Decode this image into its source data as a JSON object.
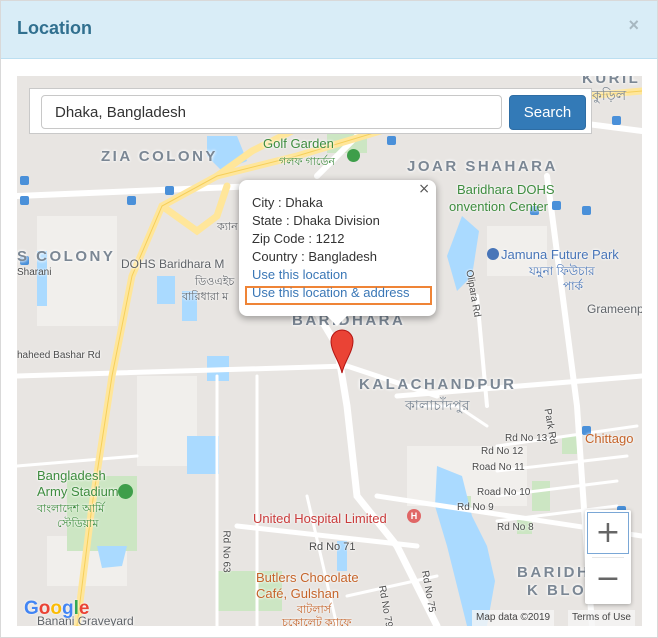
{
  "modal": {
    "title": "Location",
    "close_icon": "×"
  },
  "search": {
    "value": "Dhaka, Bangladesh",
    "button_label": "Search"
  },
  "info_window": {
    "close_icon": "×",
    "city": "City : Dhaka",
    "state": "State : Dhaka Division",
    "zip": "Zip Code : 1212",
    "country": "Country : Bangladesh",
    "link_location": "Use this location",
    "link_location_address": "Use this location & address"
  },
  "map_labels": {
    "zia_colony": "ZIA COLONY",
    "colony": "S COLONY",
    "joar_shahara": "JOAR SHAHARA",
    "baridhara": "BARIDHARA",
    "kalachandpur": "KALACHANDPUR",
    "kalachandpur_bn": "কালাচাঁদপুর",
    "baridhara_block": "BARIDHA",
    "baridhara_block2": "K BLOC",
    "golf_garden": "Golf Garden",
    "golf_garden_bn": "গলফ গার্ডেন",
    "baridhara_dohs": "Baridhara DOHS",
    "convention_center": "onvention Center",
    "jamuna": "Jamuna Future Park",
    "jamuna_bn": "যমুনা ফিউচার",
    "jamuna_bn2": "পার্ক",
    "grameenphone": "Grameenpł",
    "dohs_baridhara": "DOHS Baridhara M",
    "dohs_bn": "ডিওএইচ",
    "dohs_bn2": "বারিধারা ম",
    "bd_army_stadium": "Bangladesh",
    "bd_army_stadium2": "Army Stadium",
    "bd_army_bn": "বাংলাদেশ আর্মি",
    "bd_army_bn2": "স্টেডিয়াম",
    "united_hospital": "United Hospital Limited",
    "butlers": "Butlers Chocolate",
    "butlers2": "Café, Gulshan",
    "butlers_bn": "বাটলার্স",
    "butlers_bn2": "চকোলেট ক্যাফে",
    "banani": "Banani Graveyard",
    "chittagong": "Chittago",
    "sharani": "Sharani",
    "shaheed": "haheed Bashar Rd",
    "cant": "ক্যান",
    "kuril": "KURIL",
    "kuril_bn": "কুড়িল",
    "olipara": "Olipara Rd",
    "park_rd": "Park Rd",
    "rd13": "Rd No 13",
    "rd12": "Rd No 12",
    "rd11": "Road No 11",
    "rd10": "Road No 10",
    "rd9": "Rd No 9",
    "rd8": "Rd No 8",
    "rd71": "Rd No 71",
    "rd63": "Rd No 63",
    "rd79": "Rd No 79",
    "rd75": "Rd No 75",
    "rd82": "Rd No 8"
  },
  "zoom": {
    "in": "+",
    "out": "−"
  },
  "attribution": {
    "logo": "Google",
    "map_data": "Map data ©2019",
    "terms": "Terms of Use"
  },
  "colors": {
    "header_bg": "#d9edf7",
    "title": "#31708f",
    "search_button": "#337ab7",
    "pin": "#ea4335",
    "link": "#3a77b6",
    "highlight": "#ef8436"
  }
}
